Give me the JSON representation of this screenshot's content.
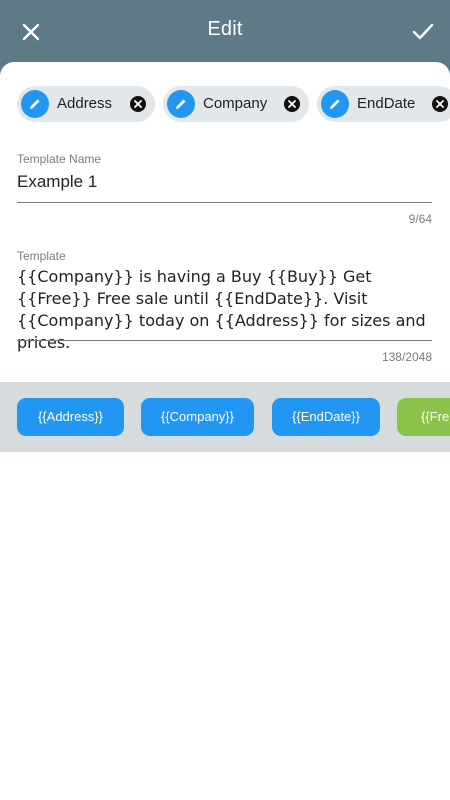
{
  "header": {
    "title": "Edit",
    "close_icon": "close-icon",
    "confirm_icon": "check-icon"
  },
  "chips": [
    {
      "label": "Address"
    },
    {
      "label": "Company"
    },
    {
      "label": "EndDate"
    }
  ],
  "template_name": {
    "label": "Template Name",
    "value": "Example 1",
    "counter": "9/64"
  },
  "template": {
    "label": "Template",
    "value": "{{Company}} is having a Buy {{Buy}} Get {{Free}} Free sale until {{EndDate}}. Visit {{Company}} today on {{Address}} for sizes and prices.",
    "counter": "138/2048"
  },
  "tags": [
    {
      "label": "{{Address}}",
      "color": "#2196f3"
    },
    {
      "label": "{{Company}}",
      "color": "#2196f3"
    },
    {
      "label": "{{EndDate}}",
      "color": "#2196f3"
    },
    {
      "label": "{{Fre",
      "color": "#8bc34a"
    }
  ],
  "colors": {
    "header_bg": "#5f7a87",
    "accent": "#2196f3",
    "tag_green": "#8bc34a"
  }
}
